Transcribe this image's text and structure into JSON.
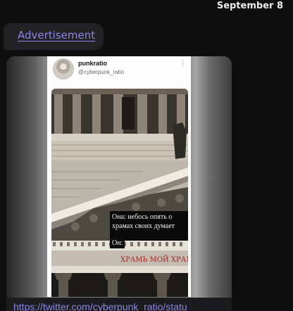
{
  "chat": {
    "date": "September 8",
    "message_link": "Advertisement",
    "url": "https://twitter.com/cyberpunk_ratio/statu"
  },
  "tweet": {
    "name": "punkratio",
    "handle": "@cyberpunk_ratio",
    "more_icon": "more-vertical-icon",
    "caption_main": "Она: небось опять о храмах своих думает",
    "caption_tail": "Он:",
    "frieze_text": "ХРАМЬ МОЙ ХРАМЬ"
  },
  "colors": {
    "background": "#0e0e0e",
    "bubble": "#222224",
    "link": "#8e84e6"
  }
}
